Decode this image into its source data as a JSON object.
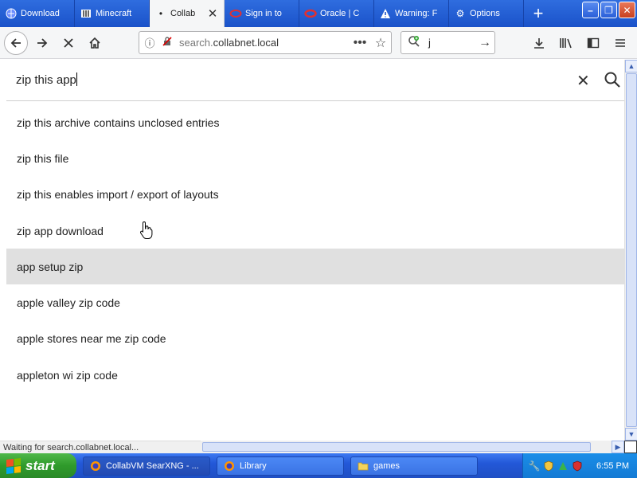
{
  "browser": {
    "tabs": [
      {
        "label": "Download",
        "icon": "globe-icon",
        "active": false
      },
      {
        "label": "Minecraft",
        "icon": "book-icon",
        "active": false
      },
      {
        "label": "Collab",
        "icon": "dot-icon",
        "active": true
      },
      {
        "label": "Sign in to",
        "icon": "ring-icon",
        "active": false
      },
      {
        "label": "Oracle | C",
        "icon": "oracle-icon",
        "active": false
      },
      {
        "label": "Warning: F",
        "icon": "warning-icon",
        "active": false
      },
      {
        "label": "Options",
        "icon": "gear-icon",
        "active": false
      }
    ],
    "url": {
      "prefix": "search.",
      "domain": "collabnet.local"
    },
    "search_value": "j"
  },
  "search": {
    "query": "zip this app",
    "suggestions": [
      "zip this archive contains unclosed entries",
      "zip this file",
      "zip this enables import / export of layouts",
      "zip app download",
      "app setup zip",
      "apple valley zip code",
      "apple stores near me zip code",
      "appleton wi zip code"
    ],
    "highlighted_index": 4
  },
  "status": {
    "text": "Waiting for search.collabnet.local..."
  },
  "taskbar": {
    "start_label": "start",
    "tasks": [
      {
        "label": "CollabVM SearXNG - ...",
        "icon": "firefox-icon"
      },
      {
        "label": "Library",
        "icon": "library-icon"
      },
      {
        "label": "games",
        "icon": "folder-icon"
      }
    ],
    "clock": "6:55 PM"
  },
  "colors": {
    "accent": "#2358d8",
    "highlight": "#e0e0e0"
  }
}
